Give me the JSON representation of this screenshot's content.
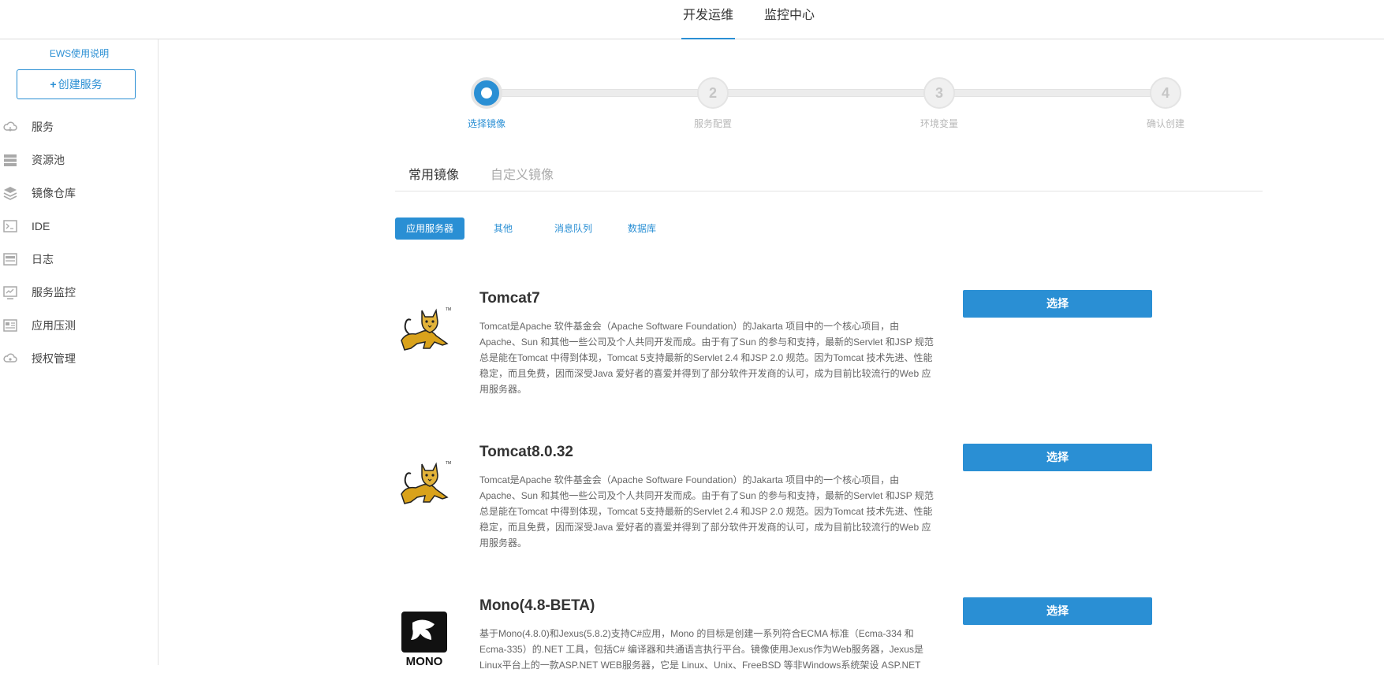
{
  "topnav": {
    "tabs": [
      {
        "label": "开发运维",
        "active": true
      },
      {
        "label": "监控中心",
        "active": false
      }
    ]
  },
  "sidebar": {
    "help_link": "EWS使用说明",
    "create_button": "创建服务",
    "items": [
      {
        "label": "服务",
        "icon": "cloud-icon"
      },
      {
        "label": "资源池",
        "icon": "server-icon"
      },
      {
        "label": "镜像仓库",
        "icon": "layers-icon"
      },
      {
        "label": "IDE",
        "icon": "terminal-icon"
      },
      {
        "label": "日志",
        "icon": "log-icon"
      },
      {
        "label": "服务监控",
        "icon": "monitor-icon"
      },
      {
        "label": "应用压测",
        "icon": "stress-test-icon"
      },
      {
        "label": "授权管理",
        "icon": "cloud-key-icon"
      }
    ]
  },
  "stepper": {
    "current_step": 1,
    "steps": [
      {
        "number": "1",
        "label": "选择镜像"
      },
      {
        "number": "2",
        "label": "服务配置"
      },
      {
        "number": "3",
        "label": "环境变量"
      },
      {
        "number": "4",
        "label": "确认创建"
      }
    ]
  },
  "image_tabs": [
    {
      "label": "常用镜像",
      "active": true
    },
    {
      "label": "自定义镜像",
      "active": false
    }
  ],
  "categories": [
    {
      "label": "应用服务器",
      "active": true
    },
    {
      "label": "其他",
      "active": false
    },
    {
      "label": "消息队列",
      "active": false
    },
    {
      "label": "数据库",
      "active": false
    }
  ],
  "images": [
    {
      "name": "Tomcat7",
      "logo": "tomcat-logo",
      "description": "Tomcat是Apache 软件基金会（Apache Software Foundation）的Jakarta 项目中的一个核心项目，由Apache、Sun 和其他一些公司及个人共同开发而成。由于有了Sun 的参与和支持，最新的Servlet 和JSP 规范总是能在Tomcat 中得到体现，Tomcat 5支持最新的Servlet 2.4 和JSP 2.0 规范。因为Tomcat 技术先进、性能稳定，而且免费，因而深受Java 爱好者的喜爱并得到了部分软件开发商的认可，成为目前比较流行的Web 应用服务器。",
      "button": "选择"
    },
    {
      "name": "Tomcat8.0.32",
      "logo": "tomcat-logo",
      "description": "Tomcat是Apache 软件基金会（Apache Software Foundation）的Jakarta 项目中的一个核心项目，由Apache、Sun 和其他一些公司及个人共同开发而成。由于有了Sun 的参与和支持，最新的Servlet 和JSP 规范总是能在Tomcat 中得到体现，Tomcat 5支持最新的Servlet 2.4 和JSP 2.0 规范。因为Tomcat 技术先进、性能稳定，而且免费，因而深受Java 爱好者的喜爱并得到了部分软件开发商的认可，成为目前比较流行的Web 应用服务器。",
      "button": "选择"
    },
    {
      "name": "Mono(4.8-BETA)",
      "logo": "mono-logo",
      "logo_text": "MONO",
      "description": "基于Mono(4.8.0)和Jexus(5.8.2)支持C#应用，Mono 的目标是创建一系列符合ECMA 标准（Ecma-334 和 Ecma-335）的.NET 工具，包括C# 编译器和共通语言执行平台。镜像使用Jexus作为Web服务器，Jexus是Linux平台上的一款ASP.NET WEB服务器，它是 Linux、Unix、FreeBSD 等非Windows系统架设 ASP.NET",
      "button": "选择"
    }
  ],
  "colors": {
    "accent": "#2a8fd4",
    "inactive_step": "#c6c6c6"
  }
}
